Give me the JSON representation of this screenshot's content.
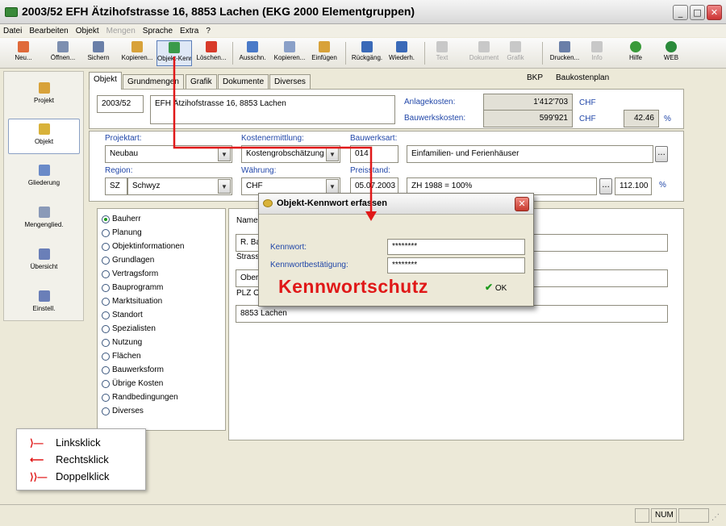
{
  "window": {
    "title": "2003/52 EFH Ätzihofstrasse 16, 8853 Lachen (EKG 2000 Elementgruppen)"
  },
  "menu": [
    {
      "label": "Datei",
      "disabled": false
    },
    {
      "label": "Bearbeiten",
      "disabled": false
    },
    {
      "label": "Objekt",
      "disabled": false
    },
    {
      "label": "Mengen",
      "disabled": true
    },
    {
      "label": "Sprache",
      "disabled": false
    },
    {
      "label": "Extra",
      "disabled": false
    },
    {
      "label": "?",
      "disabled": false
    }
  ],
  "toolbar": [
    {
      "label": "Neu...",
      "icon": "new-icon",
      "color": "#e06a3a"
    },
    {
      "label": "Öffnen...",
      "icon": "open-icon",
      "color": "#7d8fb0"
    },
    {
      "label": "Sichern",
      "icon": "save-icon",
      "color": "#6a7fa8"
    },
    {
      "label": "Kopieren...",
      "icon": "copy-icon",
      "color": "#d8a23a"
    },
    {
      "label": "Objekt-Kennwort",
      "icon": "password-icon",
      "color": "#3a9a4a"
    },
    {
      "label": "Löschen...",
      "icon": "delete-icon",
      "color": "#d83a2a"
    },
    {
      "label": "Ausschn.",
      "icon": "cut-icon",
      "color": "#4a7ac8"
    },
    {
      "label": "Kopieren...",
      "icon": "copy2-icon",
      "color": "#8aa0c8"
    },
    {
      "label": "Einfügen",
      "icon": "paste-icon",
      "color": "#d8a23a"
    },
    {
      "label": "Rückgäng.",
      "icon": "undo-icon",
      "color": "#3a6ab8"
    },
    {
      "label": "Wiederh.",
      "icon": "redo-icon",
      "color": "#3a6ab8"
    },
    {
      "label": "Text",
      "icon": "text-icon",
      "color": "#c8c8c8"
    },
    {
      "label": "Dokument",
      "icon": "document-icon",
      "color": "#c8c8c8"
    },
    {
      "label": "Grafik",
      "icon": "graphic-icon",
      "color": "#c8c8c8"
    },
    {
      "label": "Drucken...",
      "icon": "print-icon",
      "color": "#6a7fa8"
    },
    {
      "label": "Info",
      "icon": "info-icon",
      "color": "#c8c8c8"
    },
    {
      "label": "Hilfe",
      "icon": "help-icon",
      "color": "#3a9a3a"
    },
    {
      "label": "WEB",
      "icon": "web-icon",
      "color": "#2a8a3a"
    }
  ],
  "nav": [
    {
      "label": "Projekt",
      "icon": "project-icon",
      "color": "#d8a23a"
    },
    {
      "label": "Objekt",
      "icon": "object-icon",
      "color": "#d8b23a"
    },
    {
      "label": "Gliederung",
      "icon": "structure-icon",
      "color": "#6a8ac8"
    },
    {
      "label": "Mengenglied.",
      "icon": "quantity-structure-icon",
      "color": "#8a9ab8"
    },
    {
      "label": "Übersicht",
      "icon": "overview-icon",
      "color": "#6a7fb8"
    },
    {
      "label": "Einstell.",
      "icon": "settings-icon",
      "color": "#6a7fb8"
    }
  ],
  "tabs": [
    "Objekt",
    "Grundmengen",
    "Grafik",
    "Dokumente",
    "Diverses"
  ],
  "header": {
    "bkp": "BKP",
    "bkp_desc": "Baukostenplan"
  },
  "object": {
    "number": "2003/52",
    "name": "EFH Ätzihofstrasse 16, 8853 Lachen",
    "anlagekosten_label": "Anlagekosten:",
    "anlagekosten_value": "1'412'703",
    "anlagekosten_currency": "CHF",
    "bauwerkskosten_label": "Bauwerkskosten:",
    "bauwerkskosten_value": "599'921",
    "bauwerkskosten_currency": "CHF",
    "percent_value": "42.46",
    "percent_unit": "%"
  },
  "fields": {
    "projektart_label": "Projektart:",
    "projektart_value": "Neubau",
    "kostenermittlung_label": "Kostenermittlung:",
    "kostenermittlung_value": "Kostengrobschätzung",
    "bauwerksart_label": "Bauwerksart:",
    "bauwerksart_code": "014",
    "bauwerksart_value": "Einfamilien- und Ferienhäuser",
    "region_label": "Region:",
    "region_code": "SZ",
    "region_value": "Schwyz",
    "waehrung_label": "Währung:",
    "waehrung_value": "CHF",
    "preisstand_label": "Preisstand:",
    "preisstand_date": "05.07.2003",
    "preisstand_index": "ZH 1988 = 100%",
    "preisstand_value": "112.100",
    "preisstand_unit": "%",
    "ellipsis": "..."
  },
  "radio_items": [
    {
      "label": "Bauherr",
      "selected": true
    },
    {
      "label": "Planung",
      "selected": false
    },
    {
      "label": "Objektinformationen",
      "selected": false
    },
    {
      "label": "Grundlagen",
      "selected": false
    },
    {
      "label": "Vertragsform",
      "selected": false
    },
    {
      "label": "Bauprogramm",
      "selected": false
    },
    {
      "label": "Marktsituation",
      "selected": false
    },
    {
      "label": "Standort",
      "selected": false
    },
    {
      "label": "Spezialisten",
      "selected": false
    },
    {
      "label": "Nutzung",
      "selected": false
    },
    {
      "label": "Flächen",
      "selected": false
    },
    {
      "label": "Bauwerksform",
      "selected": false
    },
    {
      "label": "Übrige Kosten",
      "selected": false
    },
    {
      "label": "Randbedingungen",
      "selected": false
    },
    {
      "label": "Diverses",
      "selected": false
    }
  ],
  "details": {
    "name_label": "Name",
    "name_value": "R. Ba",
    "strasse_label": "Strass",
    "strasse_value": "Oberd",
    "plz_label": "PLZ O",
    "plz_value": "8853 Lachen"
  },
  "dialog": {
    "title": "Objekt-Kennwort erfassen",
    "close": "✕",
    "kennwort_label": "Kennwort:",
    "kennwort_value": "********",
    "bestaetigung_label": "Kennwortbestätigung:",
    "bestaetigung_value": "********",
    "ok_label": "OK"
  },
  "annotation": {
    "text": "Kennwortschutz",
    "color": "#e01818"
  },
  "legend": [
    {
      "symbol": "⟩—",
      "label": "Linksklick"
    },
    {
      "symbol": "⟵",
      "label": "Rechtsklick"
    },
    {
      "symbol": "⟩⟩—",
      "label": "Doppelklick"
    }
  ],
  "status": {
    "num": "NUM"
  }
}
